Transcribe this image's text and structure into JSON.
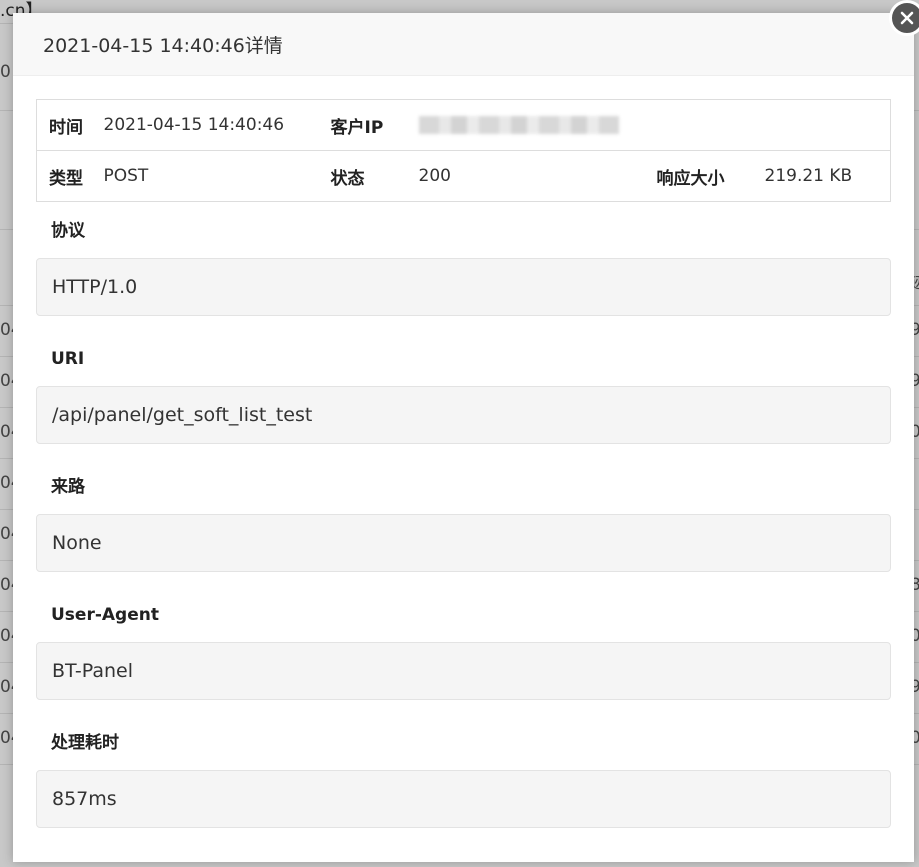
{
  "background": {
    "top_text": ".cn】",
    "left_edge": [
      "0",
      "04",
      "04",
      "04",
      "04",
      "04",
      "04",
      "04",
      "04",
      "04"
    ],
    "right_edge": [
      "迹",
      "9",
      "9",
      "0",
      "",
      "8",
      "0",
      "9",
      "0"
    ]
  },
  "modal": {
    "title": "2021-04-15 14:40:46详情",
    "close_icon": "close-icon"
  },
  "info": {
    "time_label": "时间",
    "time_value": "2021-04-15 14:40:46",
    "client_ip_label": "客户IP",
    "client_ip_value": "",
    "type_label": "类型",
    "type_value": "POST",
    "status_label": "状态",
    "status_value": "200",
    "size_label": "响应大小",
    "size_value": "219.21 KB"
  },
  "fields": {
    "protocol_label": "协议",
    "protocol_value": "HTTP/1.0",
    "uri_label": "URI",
    "uri_value": "/api/panel/get_soft_list_test",
    "referer_label": "来路",
    "referer_value": "None",
    "ua_label": "User-Agent",
    "ua_value": "BT-Panel",
    "duration_label": "处理耗时",
    "duration_value": "857ms"
  }
}
